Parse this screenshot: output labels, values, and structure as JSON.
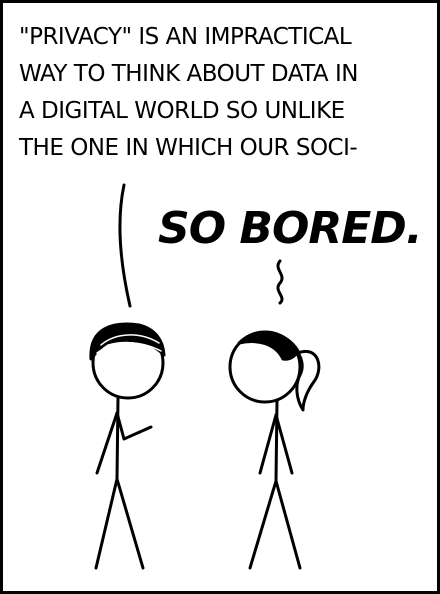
{
  "panel": {
    "speech_lines": [
      "\"PRIVACY\" IS AN IMPRACTICAL",
      "WAY TO THINK ABOUT DATA IN",
      "A DIGITAL WORLD SO UNLIKE",
      "THE ONE IN WHICH OUR SOCI-"
    ],
    "shout": "SO BORED."
  },
  "characters": [
    "short-haired-stick-figure",
    "ponytail-stick-figure"
  ],
  "colors": {
    "ink": "#000000",
    "background": "#ffffff"
  }
}
